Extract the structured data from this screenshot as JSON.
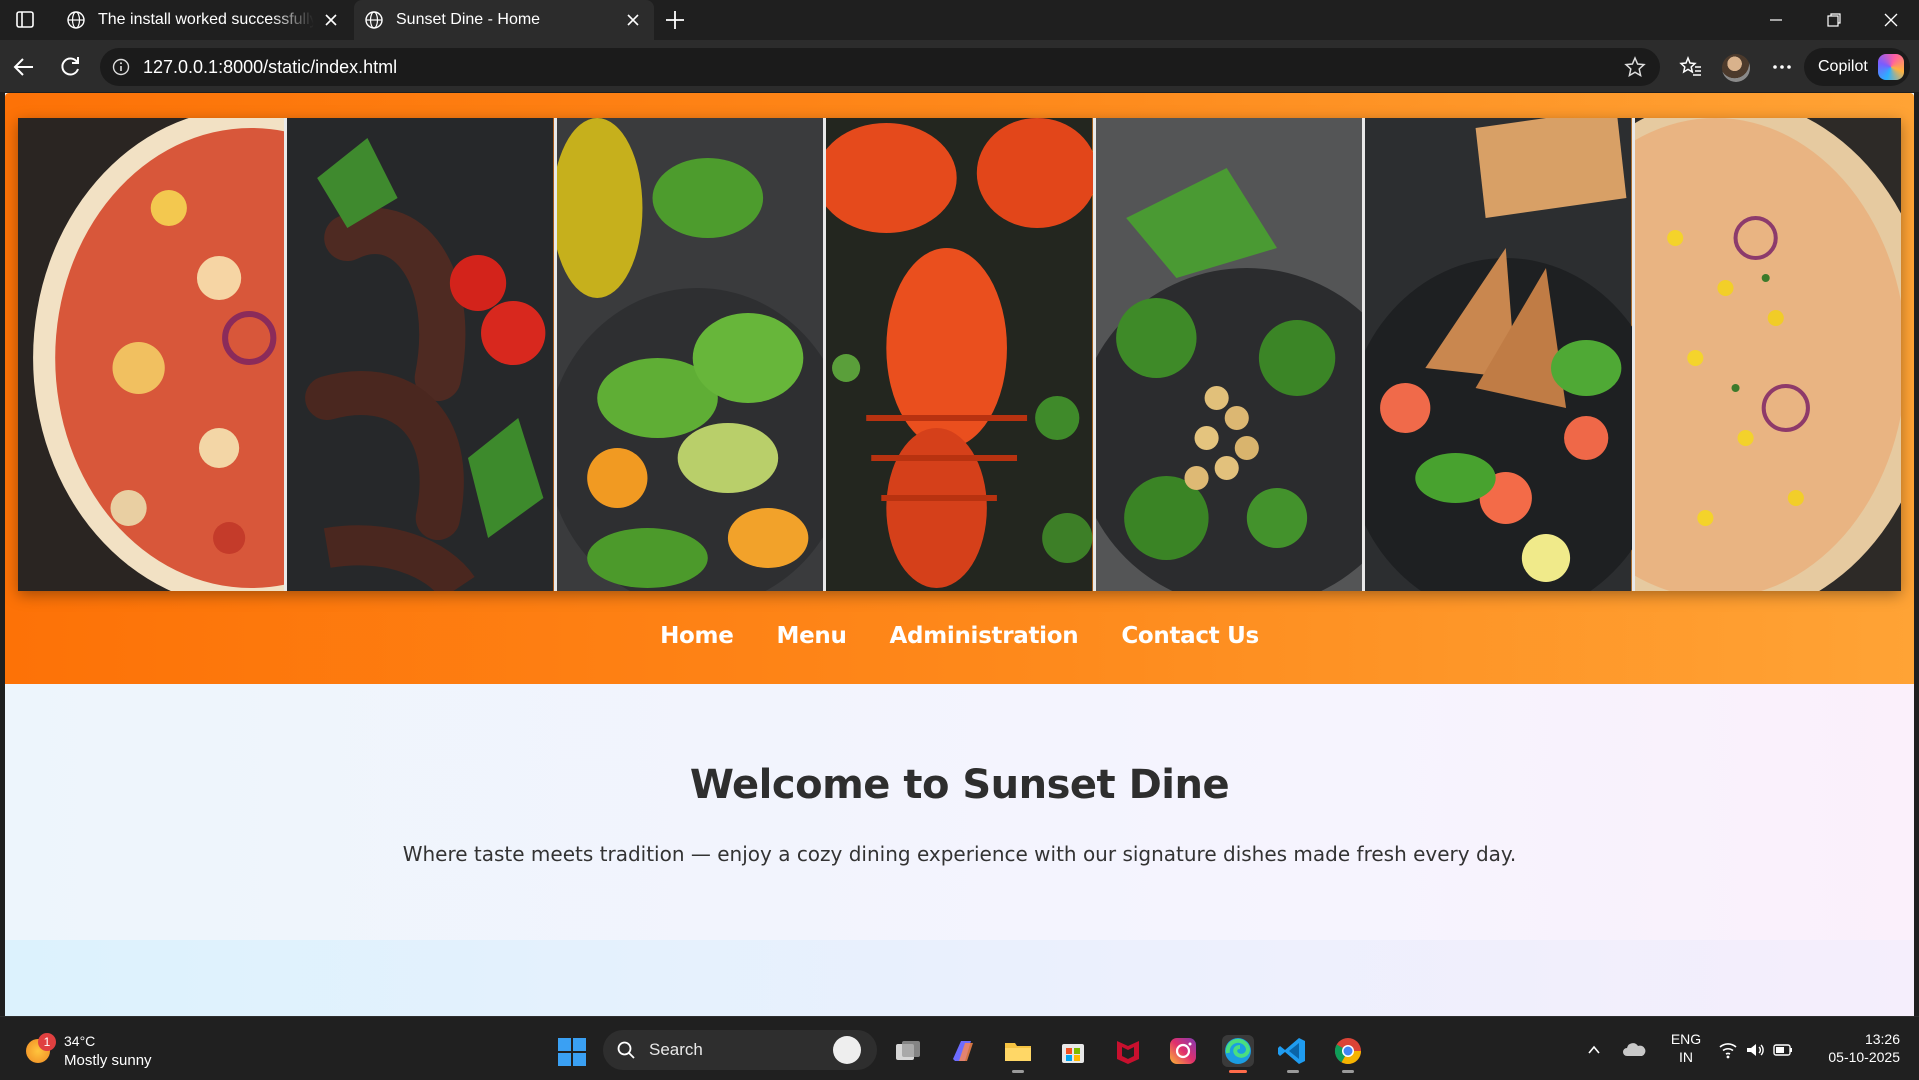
{
  "browser": {
    "tabs": [
      {
        "title": "The install worked successfully! Congratulations!",
        "active": false
      },
      {
        "title": "Sunset Dine - Home",
        "active": true
      }
    ],
    "url": "127.0.0.1:8000/static/index.html",
    "copilot_label": "Copilot"
  },
  "site": {
    "banner_images": [
      "pizza",
      "sausages-tomatoes",
      "spinach-avocado-salad",
      "lobster",
      "broccoli-chickpeas",
      "salmon-salad-toast",
      "pizza-corn"
    ],
    "nav": [
      "Home",
      "Menu",
      "Administration",
      "Contact Us"
    ],
    "hero": {
      "title": "Welcome to Sunset Dine",
      "tagline": "Where taste meets tradition — enjoy a cozy dining experience with our signature dishes made fresh every day."
    },
    "colors": {
      "header_start": "#fd7207",
      "header_end": "#ffa335",
      "heading": "#2e2e2e"
    }
  },
  "taskbar": {
    "weather": {
      "temp": "34°C",
      "condition": "Mostly sunny",
      "badge": "1"
    },
    "search_label": "Search",
    "apps": [
      "task-view",
      "copilot",
      "file-explorer",
      "microsoft-store",
      "mcafee",
      "instagram",
      "edge",
      "vscode",
      "chrome"
    ],
    "lang": [
      "ENG",
      "IN"
    ],
    "time": "13:26",
    "date": "05-10-2025"
  }
}
